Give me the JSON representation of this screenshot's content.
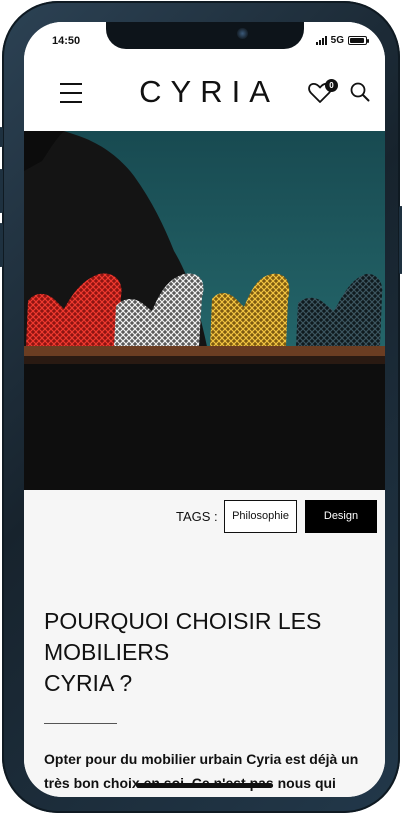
{
  "status_bar": {
    "time": "14:50",
    "network": "5G",
    "battery_level": 0.9
  },
  "header": {
    "logo": "CYRIA",
    "wishlist_count": "0",
    "icons": {
      "menu": "hamburger-menu-icon",
      "wishlist": "heart-icon",
      "search": "search-icon"
    }
  },
  "hero": {
    "subject": "four wire-mesh lounge chairs in red, white, gold and black at dusk",
    "colors": {
      "sky": "#1f5a5f",
      "red_chair": "#c8241f",
      "white_chair": "#d6d6d6",
      "gold_chair": "#d7a42a",
      "black_chair": "#1d2a2f",
      "deck": "#6b3d22"
    }
  },
  "tags": {
    "label": "TAGS :",
    "items": [
      "Philosophie",
      "Design"
    ],
    "active_index": 1
  },
  "article": {
    "title": "POURQUOI CHOISIR LES\nMOBILIERS\nCYRIA ?",
    "body": "Opter pour du mobilier urbain Cyria est déjà un très bon choix en soi. Ce n'est pas nous qui vous dirons le contraire ! Et nous"
  }
}
